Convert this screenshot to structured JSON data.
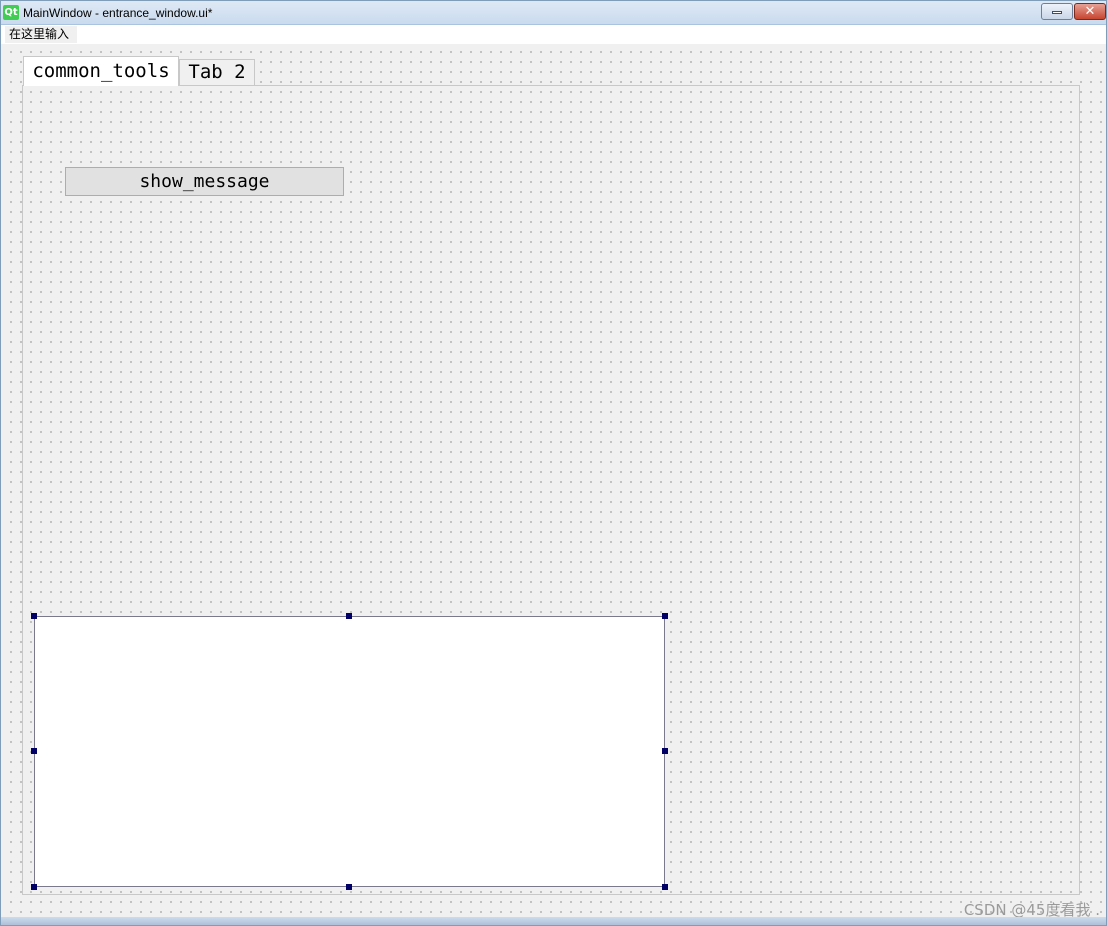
{
  "window": {
    "title": "MainWindow - entrance_window.ui*",
    "logo_text": "Qt",
    "close_glyph": "✕"
  },
  "menubar": {
    "placeholder_item": "在这里输入"
  },
  "tabs": [
    {
      "label": "common_tools",
      "active": true
    },
    {
      "label": "Tab 2",
      "active": false
    }
  ],
  "form": {
    "button_label": "show_message"
  },
  "watermark": "CSDN @45度看我 .",
  "colors": {
    "accent_qt": "#41cd52",
    "handle": "#000066",
    "form_bg": "#f0f0f0"
  }
}
